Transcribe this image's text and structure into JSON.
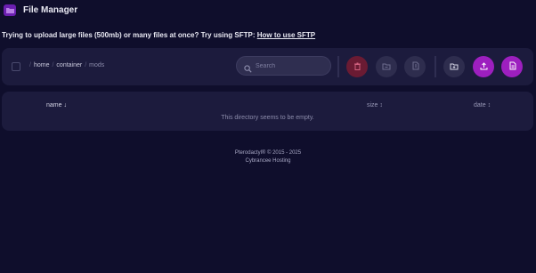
{
  "app": {
    "title": "File Manager",
    "brand_color": "#6b1fb0"
  },
  "notice": {
    "text": "Trying to upload large files (500mb) or many files at once? Try using SFTP:",
    "link": "How to use SFTP"
  },
  "breadcrumb": {
    "root": "/",
    "items": [
      "home",
      "container",
      "mods"
    ]
  },
  "search": {
    "placeholder": "Search",
    "value": ""
  },
  "actions": {
    "delete": "trash-icon",
    "move": "folder-move-icon",
    "archive": "file-archive-icon",
    "new_folder": "folder-plus-icon",
    "upload": "upload-icon",
    "new_file": "file-new-icon"
  },
  "colors": {
    "accent": "#9d1fbf",
    "danger": "#6a1b33",
    "panel": "#1c1b3d",
    "background": "#0f0e2c"
  },
  "table": {
    "columns": [
      {
        "label": "name",
        "sort": "↓"
      },
      {
        "label": "size",
        "sort": "↕"
      },
      {
        "label": "date",
        "sort": "↕"
      }
    ],
    "empty_message": "This directory seems to be empty."
  },
  "footer": {
    "line1": "Pterodactyl® © 2015 - 2025",
    "line2": "Cybrancee Hosting"
  }
}
